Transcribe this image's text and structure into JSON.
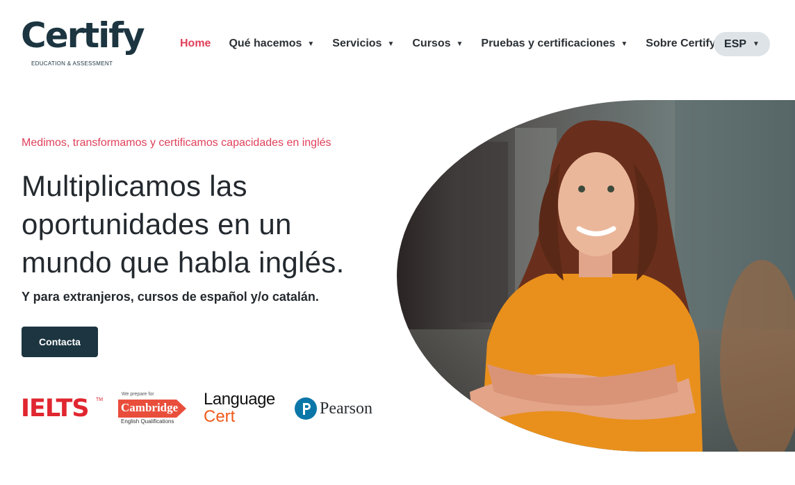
{
  "brand": {
    "name": "Certify",
    "subtitle": "EDUCATION & ASSESSMENT"
  },
  "nav": {
    "items": [
      {
        "label": "Home",
        "active": true,
        "has_dropdown": false
      },
      {
        "label": "Qué hacemos",
        "active": false,
        "has_dropdown": true
      },
      {
        "label": "Servicios",
        "active": false,
        "has_dropdown": true
      },
      {
        "label": "Cursos",
        "active": false,
        "has_dropdown": true
      },
      {
        "label": "Pruebas y certificaciones",
        "active": false,
        "has_dropdown": true
      },
      {
        "label": "Sobre Certify",
        "active": false,
        "has_dropdown": true
      }
    ],
    "language": "ESP",
    "caret": "▼"
  },
  "hero": {
    "tagline": "Medimos, transformamos y certificamos capacidades en inglés",
    "headline": "Multiplicamos las oportunidades en un mundo que habla inglés.",
    "subline": "Y para extranjeros, cursos de español y/o catalán.",
    "cta_label": "Contacta",
    "image_icon": "portrait-photo"
  },
  "partners": {
    "ielts": "IELTS",
    "ielts_tm": "TM",
    "cambridge_pre": "We prepare for",
    "cambridge": "Cambridge",
    "cambridge_sub": "English Qualifications",
    "languagecert_1": "Language",
    "languagecert_2": "Cert",
    "pearson": "Pearson"
  },
  "colors": {
    "accent": "#e0405a",
    "brand_dark": "#1c3540",
    "lang_pill": "#dde3e6",
    "ielts_red": "#e0262f",
    "cambridge_red": "#e94e3c",
    "languagecert_orange": "#ef5a1a",
    "pearson_blue": "#0b77a8"
  }
}
